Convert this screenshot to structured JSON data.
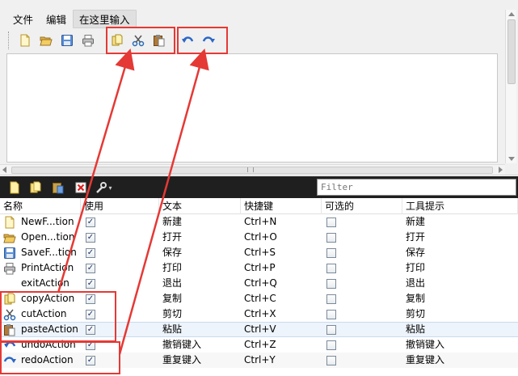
{
  "menubar": {
    "items": [
      "文件",
      "编辑",
      "在这里输入"
    ]
  },
  "editor_toolbar": {
    "buttons": [
      {
        "icon": "new-file-icon"
      },
      {
        "icon": "open-folder-icon"
      },
      {
        "icon": "save-disk-icon"
      },
      {
        "icon": "printer-icon"
      },
      {
        "icon": "copy-icon"
      },
      {
        "icon": "scissors-icon"
      },
      {
        "icon": "paste-icon"
      },
      {
        "icon": "undo-icon"
      },
      {
        "icon": "redo-icon"
      }
    ]
  },
  "dock_toolbar": {
    "buttons": [
      {
        "icon": "new-action-icon"
      },
      {
        "icon": "copy-action-icon"
      },
      {
        "icon": "paste-action-icon"
      },
      {
        "icon": "delete-icon"
      },
      {
        "icon": "wrench-icon"
      }
    ],
    "filter_placeholder": "Filter"
  },
  "table": {
    "headers": [
      "名称",
      "使用",
      "文本",
      "快捷键",
      "可选的",
      "工具提示"
    ],
    "rows": [
      {
        "name": "NewF...tion",
        "icon": "new-file-icon",
        "used": true,
        "text": "新建",
        "shortcut": "Ctrl+N",
        "checkable": false,
        "tooltip": "新建"
      },
      {
        "name": "Open...tion",
        "icon": "open-folder-icon",
        "used": true,
        "text": "打开",
        "shortcut": "Ctrl+O",
        "checkable": false,
        "tooltip": "打开"
      },
      {
        "name": "SaveF...tion",
        "icon": "save-disk-icon",
        "used": true,
        "text": "保存",
        "shortcut": "Ctrl+S",
        "checkable": false,
        "tooltip": "保存"
      },
      {
        "name": "PrintAction",
        "icon": "printer-icon",
        "used": true,
        "text": "打印",
        "shortcut": "Ctrl+P",
        "checkable": false,
        "tooltip": "打印"
      },
      {
        "name": "exitAction",
        "icon": "",
        "used": true,
        "text": "退出",
        "shortcut": "Ctrl+Q",
        "checkable": false,
        "tooltip": "退出"
      },
      {
        "name": "copyAction",
        "icon": "copy-icon",
        "used": true,
        "text": "复制",
        "shortcut": "Ctrl+C",
        "checkable": false,
        "tooltip": "复制"
      },
      {
        "name": "cutAction",
        "icon": "scissors-icon",
        "used": true,
        "text": "剪切",
        "shortcut": "Ctrl+X",
        "checkable": false,
        "tooltip": "剪切"
      },
      {
        "name": "pasteAction",
        "icon": "paste-icon",
        "used": true,
        "text": "粘贴",
        "shortcut": "Ctrl+V",
        "checkable": false,
        "tooltip": "粘贴"
      },
      {
        "name": "undoAction",
        "icon": "undo-icon",
        "used": true,
        "text": "撤销键入",
        "shortcut": "Ctrl+Z",
        "checkable": false,
        "tooltip": "撤销键入"
      },
      {
        "name": "redoAction",
        "icon": "redo-icon",
        "used": true,
        "text": "重复键入",
        "shortcut": "Ctrl+Y",
        "checkable": false,
        "tooltip": "重复键入"
      }
    ]
  },
  "colors": {
    "annotation": "#e53935",
    "dock_toolbar_bg": "#1f1f1f",
    "selected_row": "#eef4fb"
  }
}
